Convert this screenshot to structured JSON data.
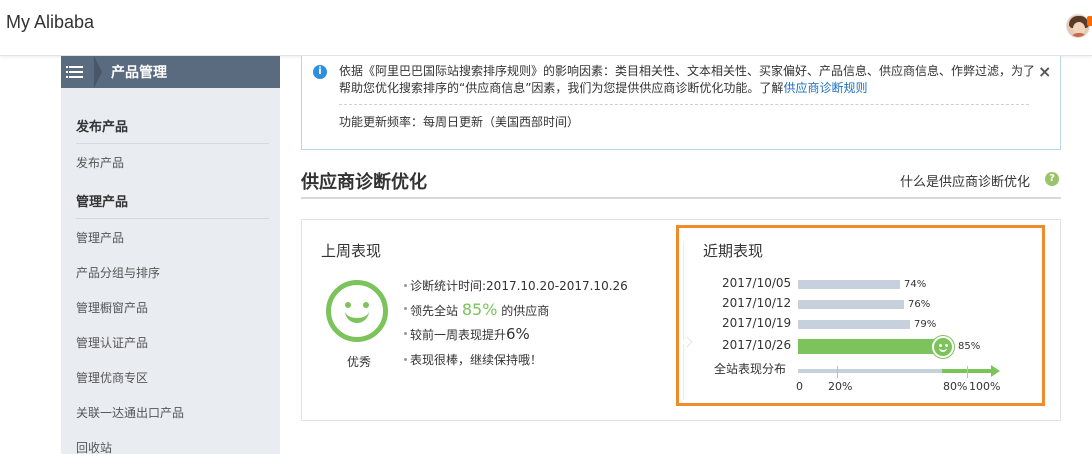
{
  "header": {
    "brand": "My Alibaba",
    "avatar_icon": "user-avatar-icon"
  },
  "sidebar": {
    "title": "产品管理",
    "sections": [
      {
        "heading": "发布产品",
        "items": [
          "发布产品"
        ]
      },
      {
        "heading": "管理产品",
        "items": [
          "管理产品",
          "产品分组与排序",
          "管理橱窗产品",
          "管理认证产品",
          "管理优商专区",
          "关联一达通出口产品",
          "回收站"
        ]
      }
    ]
  },
  "notice": {
    "text": "依据《阿里巴巴国际站搜索排序规则》的影响因素：类目相关性、文本相关性、买家偏好、产品信息、供应商信息、作弊过滤，为了帮助您优化搜索排序的“供应商信息”因素，我们为您提供供应商诊断优化功能。了解",
    "link": "供应商诊断规则",
    "frequency": "功能更新频率：每周日更新（美国西部时间）",
    "close": "×"
  },
  "section": {
    "title": "供应商诊断优化",
    "help": "什么是供应商诊断优化",
    "help_icon": "?"
  },
  "last_week": {
    "title": "上周表现",
    "grade": "优秀",
    "period": "诊断统计时间:2017.10.20-2017.10.26",
    "lead_prefix": "领先全站 ",
    "lead_pct": "85%",
    "lead_suffix": " 的供应商",
    "improve_prefix": "较前一周表现提升",
    "improve_pct": "6%",
    "comment": "表现很棒，继续保持哦！"
  },
  "recent": {
    "title": "近期表现",
    "distribution_label": "全站表现分布",
    "ticks": [
      "0",
      "20%",
      "80%",
      "100%"
    ]
  },
  "chart_data": {
    "type": "bar",
    "categories": [
      "2017/10/05",
      "2017/10/12",
      "2017/10/19",
      "2017/10/26"
    ],
    "values": [
      74,
      76,
      79,
      85
    ],
    "labels": [
      "74%",
      "76%",
      "79%",
      "85%"
    ],
    "ylim": [
      0,
      100
    ],
    "colors": {
      "past": "#c7d0dd",
      "current": "#7cc35b"
    }
  }
}
